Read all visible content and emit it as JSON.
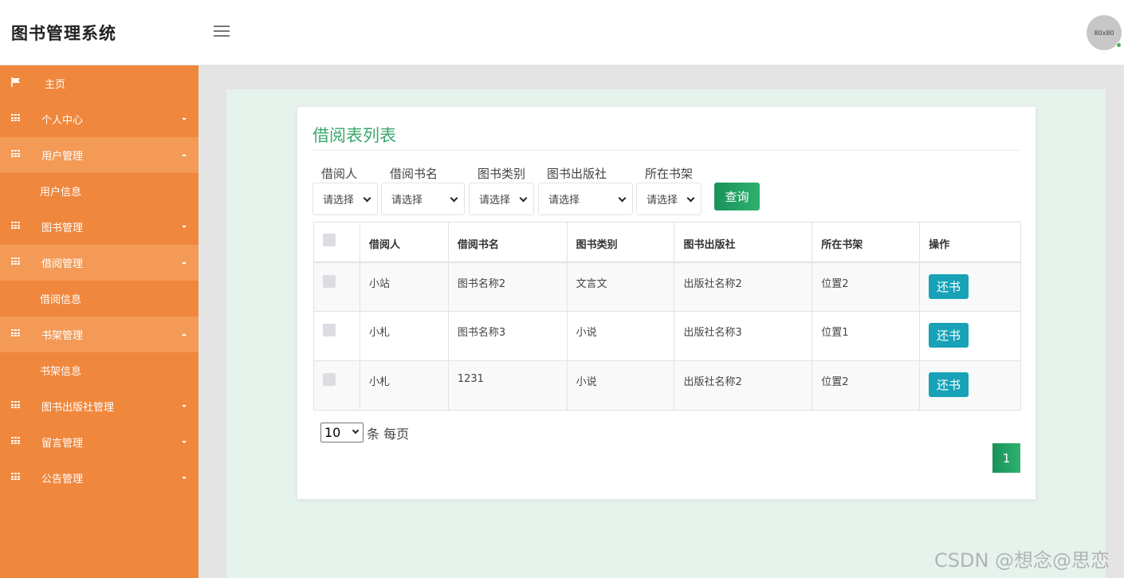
{
  "header": {
    "brand": "图书管理系统",
    "avatar_text": "80x80"
  },
  "sidebar": {
    "items": [
      {
        "label": "主页",
        "icon": "flag-icon",
        "type": "item"
      },
      {
        "label": "个人中心",
        "icon": "grid-icon",
        "type": "group",
        "expanded": false
      },
      {
        "label": "用户管理",
        "icon": "grid-icon",
        "type": "group",
        "expanded": true,
        "children": [
          "用户信息"
        ]
      },
      {
        "label": "图书管理",
        "icon": "grid-icon",
        "type": "group",
        "expanded": false
      },
      {
        "label": "借阅管理",
        "icon": "grid-icon",
        "type": "group",
        "expanded": true,
        "children": [
          "借阅信息"
        ]
      },
      {
        "label": "书架管理",
        "icon": "grid-icon",
        "type": "group",
        "expanded": true,
        "children": [
          "书架信息"
        ]
      },
      {
        "label": "图书出版社管理",
        "icon": "grid-icon",
        "type": "group",
        "expanded": false
      },
      {
        "label": "留言管理",
        "icon": "grid-icon",
        "type": "group",
        "expanded": false
      },
      {
        "label": "公告管理",
        "icon": "grid-icon",
        "type": "group",
        "expanded": false
      }
    ]
  },
  "main": {
    "title": "借阅表列表",
    "filters": [
      {
        "label": "借阅人",
        "placeholder": "请选择"
      },
      {
        "label": "借阅书名",
        "placeholder": "请选择"
      },
      {
        "label": "图书类别",
        "placeholder": "请选择"
      },
      {
        "label": "图书出版社",
        "placeholder": "请选择"
      },
      {
        "label": "所在书架",
        "placeholder": "请选择"
      }
    ],
    "query_label": "查询",
    "table": {
      "columns": [
        "借阅人",
        "借阅书名",
        "图书类别",
        "图书出版社",
        "所在书架",
        "操作"
      ],
      "rows": [
        [
          "小站",
          "图书名称2",
          "文言文",
          "出版社名称2",
          "位置2"
        ],
        [
          "小札",
          "图书名称3",
          "小说",
          "出版社名称3",
          "位置1"
        ],
        [
          "小札",
          "1231",
          "小说",
          "出版社名称2",
          "位置2"
        ]
      ],
      "action_label": "还书"
    },
    "pagination": {
      "per_page": "10",
      "per_page_suffix": "条 每页",
      "current_page": "1"
    }
  },
  "watermark": "CSDN @想念@思恋",
  "colors": {
    "sidebar": "#ef873d",
    "sidebar_open": "#f29a56",
    "title_green": "#3aa76d",
    "button_green": "#19925a",
    "action_teal": "#17a2b8"
  }
}
